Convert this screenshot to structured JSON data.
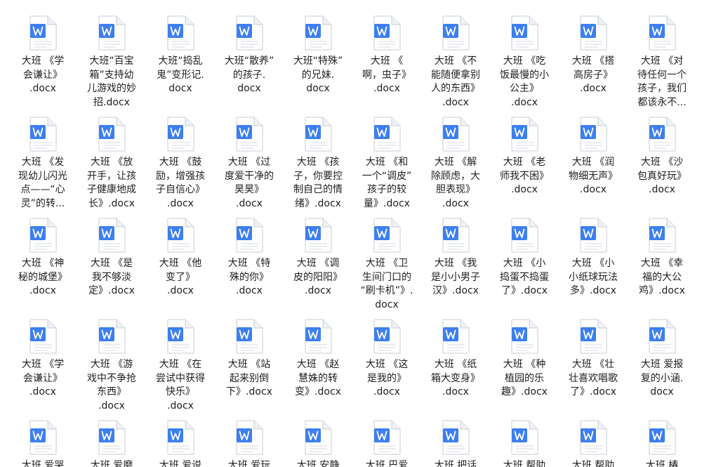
{
  "explorer": {
    "icon_name": "word-document-icon",
    "accent_color": "#3d7ff0",
    "files": [
      [
        {
          "label": "大班 《学会谦让》.docx",
          "lines": [
            "大班 《学",
            "会谦让》",
            ".docx"
          ]
        },
        {
          "label": "大班“百宝箱”支持幼儿游戏的妙招.docx",
          "lines": [
            "大班“百宝",
            "箱”支持幼",
            "儿游戏的妙",
            "招.docx"
          ]
        },
        {
          "label": "大班“捣乱鬼”变形记.docx",
          "lines": [
            "大班“捣乱",
            "鬼”变形记.",
            "docx"
          ]
        },
        {
          "label": "大班“散养”的孩子.docx",
          "lines": [
            "大班“散养”",
            "的孩子.",
            "docx"
          ]
        },
        {
          "label": "大班“特殊”的兄妹.docx",
          "lines": [
            "大班“特殊”",
            "的兄妹.",
            "docx"
          ]
        },
        {
          "label": "大班 《啊，虫子》.docx",
          "lines": [
            "大班 《",
            "啊，虫子》",
            ".docx"
          ]
        },
        {
          "label": "大班 《不能随便拿别人的东西》.docx",
          "lines": [
            "大班 《不",
            "能随便拿别",
            "人的东西》",
            ".docx"
          ]
        },
        {
          "label": "大班 《吃饭最慢的小公主》.docx",
          "lines": [
            "大班 《吃",
            "饭最慢的小",
            "公主》",
            ".docx"
          ]
        },
        {
          "label": "大班 《搭高房子》.docx",
          "lines": [
            "大班 《搭",
            "高房子》",
            ".docx"
          ]
        },
        {
          "label": "大班 《对待任何一个孩子，我们都该永不...",
          "lines": [
            "大班 《对",
            "待任何一个",
            "孩子，我们",
            "都该永不..."
          ]
        }
      ],
      [
        {
          "label": "大班 《发现幼儿闪光点——“心灵”的转...",
          "lines": [
            "大班 《发",
            "现幼儿闪光",
            "点——“心",
            "灵”的转..."
          ]
        },
        {
          "label": "大班 《放开手，让孩子健康地成长》.docx",
          "lines": [
            "大班 《放",
            "开手，让孩",
            "子健康地成",
            "长》.docx"
          ]
        },
        {
          "label": "大班 《鼓励，增强孩子自信心》.docx",
          "lines": [
            "大班 《鼓",
            "励，增强孩",
            "子自信心》",
            ".docx"
          ]
        },
        {
          "label": "大班 《过度爱干净的昊昊》.docx",
          "lines": [
            "大班 《过",
            "度爱干净的",
            "昊昊》",
            ".docx"
          ]
        },
        {
          "label": "大班 《孩子，你要控制自己的情绪》.docx",
          "lines": [
            "大班 《孩",
            "子，你要控",
            "制自己的情",
            "绪》.docx"
          ]
        },
        {
          "label": "大班 《和一个“调皮”孩子的较量》.docx",
          "lines": [
            "大班 《和",
            "一个“调皮”",
            "孩子的较",
            "量》.docx"
          ]
        },
        {
          "label": "大班 《解除顾虑，大胆表现》.docx",
          "lines": [
            "大班 《解",
            "除顾虑，大",
            "胆表现》",
            ".docx"
          ]
        },
        {
          "label": "大班 《老师我不困》.docx",
          "lines": [
            "大班 《老",
            "师我不困》",
            ".docx"
          ]
        },
        {
          "label": "大班 《润物细无声》.docx",
          "lines": [
            "大班 《润",
            "物细无声》",
            ".docx"
          ]
        },
        {
          "label": "大班 《沙包真好玩》.docx",
          "lines": [
            "大班 《沙",
            "包真好玩》",
            ".docx"
          ]
        }
      ],
      [
        {
          "label": "大班 《神秘的城堡》.docx",
          "lines": [
            "大班 《神",
            "秘的城堡》",
            ".docx"
          ]
        },
        {
          "label": "大班 《是我不够淡定》.docx",
          "lines": [
            "大班 《是",
            "我不够淡",
            "定》.docx"
          ]
        },
        {
          "label": "大班 《他变了》.docx",
          "lines": [
            "大班 《他",
            "变了》",
            ".docx"
          ]
        },
        {
          "label": "大班 《特殊的你》.docx",
          "lines": [
            "大班 《特",
            "殊的你》",
            ".docx"
          ]
        },
        {
          "label": "大班 《调皮的阳阳》.docx",
          "lines": [
            "大班 《调",
            "皮的阳阳》",
            ".docx"
          ]
        },
        {
          "label": "大班 《卫生间门口的“刷卡机”》.docx",
          "lines": [
            "大班 《卫",
            "生间门口的",
            "“刷卡机”》.",
            "docx"
          ]
        },
        {
          "label": "大班 《我是小小男子汉》.docx",
          "lines": [
            "大班 《我",
            "是小小男子",
            "汉》.docx"
          ]
        },
        {
          "label": "大班 《小捣蛋不捣蛋了》.docx",
          "lines": [
            "大班 《小",
            "捣蛋不捣蛋",
            "了》.docx"
          ]
        },
        {
          "label": "大班 《小小纸球玩法多》.docx",
          "lines": [
            "大班 《小",
            "小纸球玩法",
            "多》.docx"
          ]
        },
        {
          "label": "大班 《幸福的大公鸡》.docx",
          "lines": [
            "大班 《幸",
            "福的大公",
            "鸡》.docx"
          ]
        }
      ],
      [
        {
          "label": "大班 《学会谦让》.docx",
          "lines": [
            "大班 《学",
            "会谦让》",
            ".docx"
          ]
        },
        {
          "label": "大班 《游戏中不争抢东西》.docx",
          "lines": [
            "大班 《游",
            "戏中不争抢",
            "东西》",
            ".docx"
          ]
        },
        {
          "label": "大班 《在尝试中获得快乐》.docx",
          "lines": [
            "大班 《在",
            "尝试中获得",
            "快乐》",
            ".docx"
          ]
        },
        {
          "label": "大班 《站起来别倒下》.docx",
          "lines": [
            "大班 《站",
            "起来别倒",
            "下》.docx"
          ]
        },
        {
          "label": "大班 《赵慧姝的转变》.docx",
          "lines": [
            "大班 《赵",
            "慧姝的转",
            "变》.docx"
          ]
        },
        {
          "label": "大班 《这是我的》.docx",
          "lines": [
            "大班 《这",
            "是我的》",
            ".docx"
          ]
        },
        {
          "label": "大班 《纸箱大变身》.docx",
          "lines": [
            "大班 《纸",
            "箱大变身》",
            ".docx"
          ]
        },
        {
          "label": "大班 《种植园的乐趣》.docx",
          "lines": [
            "大班 《种",
            "植园的乐",
            "趣》.docx"
          ]
        },
        {
          "label": "大班 《壮壮喜欢唱歌了》.docx",
          "lines": [
            "大班 《壮",
            "壮喜欢唱歌",
            "了》.docx"
          ]
        },
        {
          "label": "大班 爱报复的小涵.docx",
          "lines": [
            "大班 爱报",
            "复的小涵.",
            "docx"
          ]
        }
      ],
      [
        {
          "label": "大班 爱哭",
          "lines": [
            "大班 爱哭"
          ]
        },
        {
          "label": "大班 爱磨",
          "lines": [
            "大班 爱磨"
          ]
        },
        {
          "label": "大班 爱说",
          "lines": [
            "大班 爱说"
          ]
        },
        {
          "label": "大班 爱玩",
          "lines": [
            "大班 爱玩"
          ]
        },
        {
          "label": "大班 安静",
          "lines": [
            "大班 安静"
          ]
        },
        {
          "label": "大班 巴爱",
          "lines": [
            "大班 巴爱"
          ]
        },
        {
          "label": "大班 把话",
          "lines": [
            "大班 把话"
          ]
        },
        {
          "label": "大班 帮助",
          "lines": [
            "大班 帮助"
          ]
        },
        {
          "label": "大班 帮助",
          "lines": [
            "大班 帮助"
          ]
        },
        {
          "label": "大班 椿",
          "lines": [
            "大班 椿"
          ]
        }
      ]
    ]
  }
}
